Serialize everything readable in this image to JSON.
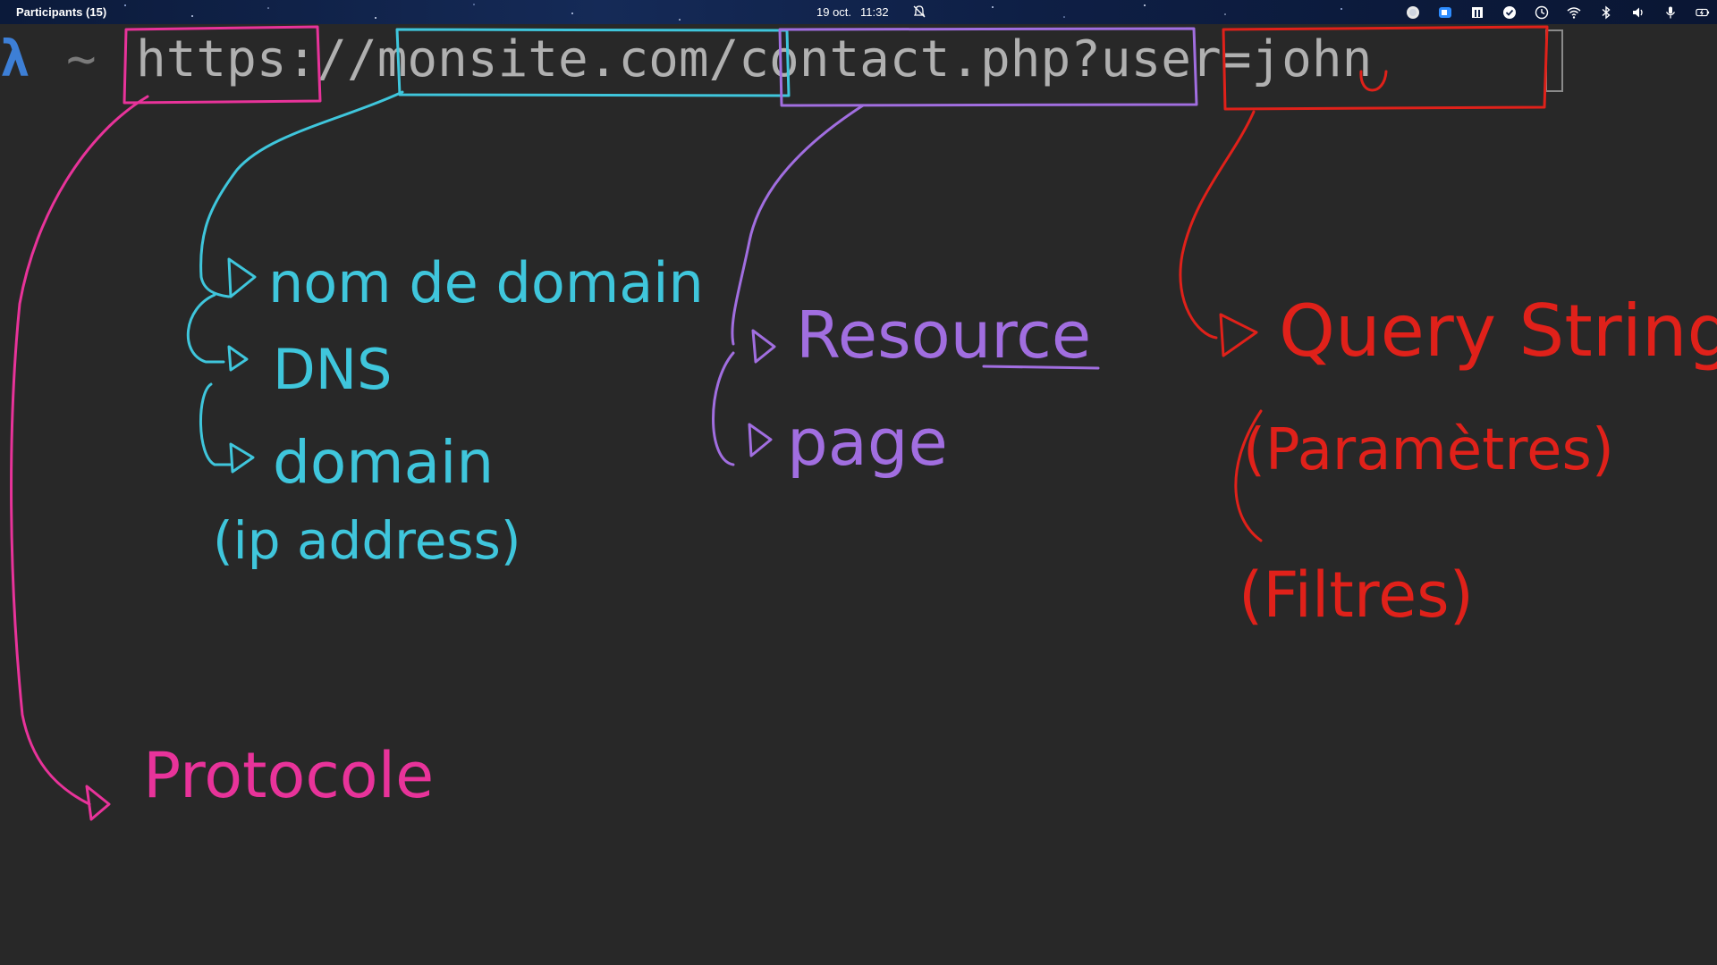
{
  "menubar": {
    "title": "Participants (15)",
    "date": "19 oct.",
    "time": "11:32",
    "tray_icons": [
      "record-icon",
      "zoom-icon",
      "grid-icon",
      "check-icon",
      "clock-icon",
      "wifi-icon",
      "bluetooth-icon",
      "volume-icon",
      "microphone-icon",
      "battery-icon"
    ]
  },
  "terminal": {
    "prompt_symbol": "λ",
    "cwd": "~",
    "command": "https://monsite.com/contact.php?user=john"
  },
  "annotations": {
    "protocol": "Protocole",
    "domain_name": "nom de domain",
    "dns": "DNS",
    "domain": "domain",
    "ip_address": "(ip address)",
    "resource": "Resource",
    "page": "page",
    "query_string": "Query String",
    "parameters": "(Paramètres)",
    "filters": "(Filtres)"
  },
  "colors": {
    "pink": "#e8339a",
    "cyan": "#3fc6dc",
    "purple": "#a16ee0",
    "red": "#e0211a",
    "background": "#282828"
  }
}
